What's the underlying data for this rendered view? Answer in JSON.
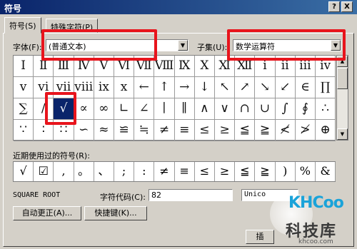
{
  "window": {
    "title": "符号",
    "help_label": "?",
    "close_label": "X"
  },
  "tabs": [
    {
      "label": "符号(S)"
    },
    {
      "label": "特殊字符(P)"
    }
  ],
  "font": {
    "label": "字体(F):",
    "value": "(普通文本)"
  },
  "subset": {
    "label": "子集(U):",
    "value": "数学运算符"
  },
  "symbols": [
    "Ⅰ",
    "Ⅱ",
    "Ⅲ",
    "Ⅳ",
    "Ⅴ",
    "Ⅵ",
    "Ⅶ",
    "Ⅷ",
    "Ⅸ",
    "Ⅹ",
    "Ⅺ",
    "Ⅻ",
    "ⅰ",
    "ⅱ",
    "ⅲ",
    "ⅳ",
    "ⅴ",
    "ⅵ",
    "ⅶ",
    "ⅷ",
    "ⅸ",
    "ⅹ",
    "←",
    "↑",
    "→",
    "↓",
    "↖",
    "↗",
    "↘",
    "↙",
    "∈",
    "∏",
    "∑",
    "∕",
    "√",
    "∝",
    "∞",
    "∟",
    "∠",
    "∣",
    "∥",
    "∧",
    "∨",
    "∩",
    "∪",
    "∫",
    "∮",
    "∴",
    "∵",
    "∶",
    "∷",
    "∽",
    "≈",
    "≌",
    "≒",
    "≠",
    "≡",
    "≤",
    "≥",
    "≦",
    "≧",
    "≮",
    "≯",
    "⊕"
  ],
  "selected_symbol": "√",
  "recent": {
    "label": "近期使用过的符号(R):",
    "items": [
      "√",
      "☑",
      ",",
      "。",
      "、",
      ";",
      ":",
      "≠",
      "≡",
      "≤",
      "≥",
      "≦",
      "≧",
      ")",
      "%",
      "&"
    ]
  },
  "char_name": "SQUARE ROOT",
  "char_code": {
    "label": "字符代码(C):",
    "value": "82"
  },
  "from_value": "Unico",
  "buttons": {
    "autocorrect": "自动更正(A)...",
    "shortcut": "快捷键(K)...",
    "insert": "插"
  },
  "watermark": {
    "logo": "KHCoo",
    "name": "科技库",
    "url": "khcoo.com"
  }
}
